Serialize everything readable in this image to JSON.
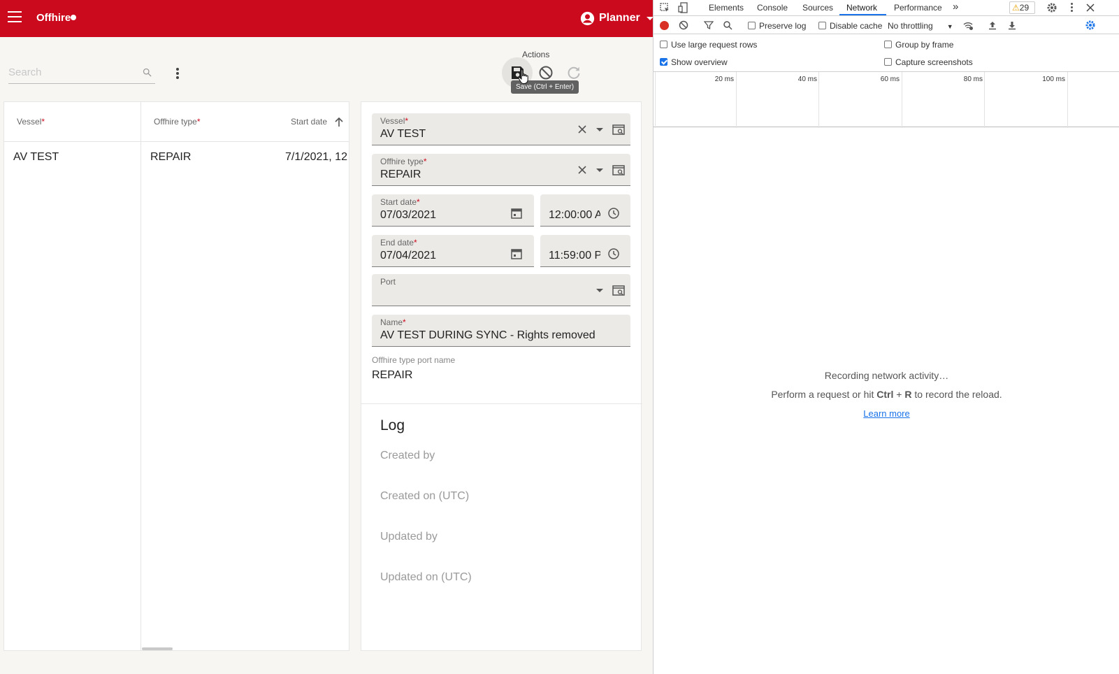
{
  "app": {
    "title": "Offhire",
    "user": "Planner",
    "search_placeholder": "Search",
    "actions_label": "Actions",
    "save_tooltip": "Save (Ctrl + Enter)",
    "brand_color": "#cc0a1e"
  },
  "table": {
    "columns": [
      {
        "label": "Vessel",
        "required": "*"
      },
      {
        "label": "Offhire type",
        "required": "*"
      },
      {
        "label": "Start date"
      }
    ],
    "rows": [
      {
        "vessel": "AV TEST",
        "offhire_type": "REPAIR",
        "start_date": "7/1/2021, 12"
      }
    ]
  },
  "form": {
    "vessel": {
      "label": "Vessel",
      "value": "AV TEST"
    },
    "offhire_type": {
      "label": "Offhire type",
      "value": "REPAIR"
    },
    "start_date": {
      "label": "Start date",
      "date": "07/03/2021",
      "time": "12:00:00 A"
    },
    "end_date": {
      "label": "End date",
      "date": "07/04/2021",
      "time": "11:59:00 P"
    },
    "port": {
      "label": "Port",
      "value": ""
    },
    "name": {
      "label": "Name",
      "value": "AV TEST DURING SYNC - Rights removed"
    },
    "offhire_type_port_name": {
      "label": "Offhire type port name",
      "value": "REPAIR"
    },
    "required_marker": "*"
  },
  "log": {
    "title": "Log",
    "items": [
      "Created by",
      "Created on (UTC)",
      "Updated by",
      "Updated on (UTC)"
    ]
  },
  "devtools": {
    "tabs": [
      "Elements",
      "Console",
      "Sources",
      "Network",
      "Performance"
    ],
    "more": "»",
    "warning_count": "29",
    "toolbar": {
      "preserve_log": "Preserve log",
      "disable_cache": "Disable cache",
      "throttling": "No throttling"
    },
    "options": {
      "large_rows": "Use large request rows",
      "group_by_frame": "Group by frame",
      "show_overview": "Show overview",
      "capture_screenshots": "Capture screenshots"
    },
    "ticks": [
      "20 ms",
      "40 ms",
      "60 ms",
      "80 ms",
      "100 ms"
    ],
    "empty": {
      "line1": "Recording network activity…",
      "line2_prefix": "Perform a request or hit ",
      "line2_keys_a": "Ctrl",
      "line2_plus": " + ",
      "line2_keys_b": "R",
      "line2_suffix": " to record the reload.",
      "learn_more": "Learn more"
    },
    "accent_color": "#1a73e8"
  }
}
